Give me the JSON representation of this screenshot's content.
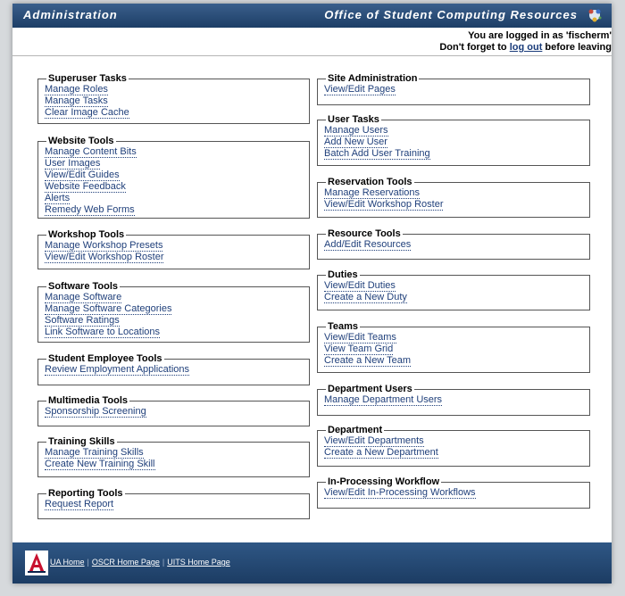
{
  "header": {
    "left_title": "Administration",
    "right_title": "Office of Student Computing Resources",
    "logo_icon": "oscr-sparkle-icon"
  },
  "user": {
    "logged_in_prefix": "You are logged in as 'fischerm'",
    "reminder_prefix": "Don't forget to",
    "logout_label": "log out",
    "reminder_suffix": "before leaving"
  },
  "sections": {
    "superuser": {
      "title": "Superuser Tasks",
      "links": [
        "Manage Roles",
        "Manage Tasks",
        "Clear Image Cache"
      ]
    },
    "website": {
      "title": "Website Tools",
      "links": [
        "Manage Content Bits",
        "User Images",
        "View/Edit Guides",
        "Website Feedback",
        "Alerts",
        "Remedy Web Forms"
      ]
    },
    "workshop": {
      "title": "Workshop Tools",
      "links": [
        "Manage Workshop Presets",
        "View/Edit Workshop Roster"
      ]
    },
    "software": {
      "title": "Software Tools",
      "links": [
        "Manage Software",
        "Manage Software Categories",
        "Software Ratings",
        "Link Software to Locations"
      ]
    },
    "student_employee": {
      "title": "Student Employee Tools",
      "links": [
        "Review Employment Applications"
      ]
    },
    "multimedia": {
      "title": "Multimedia Tools",
      "links": [
        "Sponsorship Screening"
      ]
    },
    "training": {
      "title": "Training Skills",
      "links": [
        "Manage Training Skills",
        "Create New Training Skill"
      ]
    },
    "reporting": {
      "title": "Reporting Tools",
      "links": [
        "Request Report"
      ]
    },
    "site_admin": {
      "title": "Site Administration",
      "links": [
        "View/Edit Pages"
      ]
    },
    "user_tasks": {
      "title": "User Tasks",
      "links": [
        "Manage Users",
        "Add New User",
        "Batch Add User Training"
      ]
    },
    "reservation": {
      "title": "Reservation Tools",
      "links": [
        "Manage Reservations",
        "View/Edit Workshop Roster"
      ]
    },
    "resource": {
      "title": "Resource Tools",
      "links": [
        "Add/Edit Resources"
      ]
    },
    "duties": {
      "title": "Duties",
      "links": [
        "View/Edit Duties",
        "Create a New Duty"
      ]
    },
    "teams": {
      "title": "Teams",
      "links": [
        "View/Edit Teams",
        "View Team Grid",
        "Create a New Team"
      ]
    },
    "dept_users": {
      "title": "Department Users",
      "links": [
        "Manage Department Users"
      ]
    },
    "department": {
      "title": "Department",
      "links": [
        "View/Edit Departments",
        "Create a New Department"
      ]
    },
    "inprocessing": {
      "title": "In-Processing Workflow",
      "links": [
        "View/Edit In-Processing Workflows"
      ]
    }
  },
  "footer": {
    "logo_icon": "university-a-logo-icon",
    "links": [
      "UA Home",
      "OSCR Home Page",
      "UITS Home Page"
    ]
  }
}
